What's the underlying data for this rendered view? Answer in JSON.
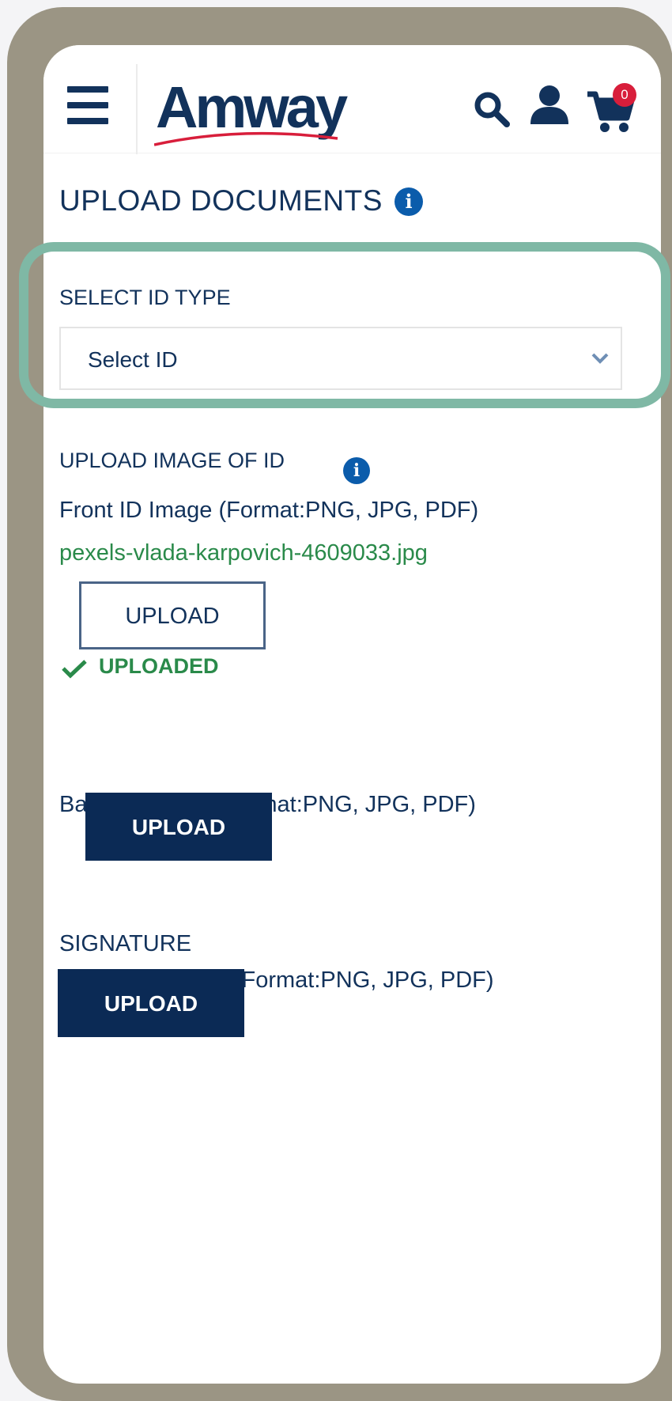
{
  "header": {
    "logo_text": "Amway",
    "cart_count": "0",
    "icons": [
      "hamburger-menu-icon",
      "search-icon",
      "account-icon",
      "cart-icon"
    ]
  },
  "page": {
    "title": "UPLOAD DOCUMENTS"
  },
  "id_type": {
    "label": "SELECT ID TYPE",
    "selected": "Select ID"
  },
  "upload_id": {
    "label": "UPLOAD IMAGE OF ID",
    "front_label": "Front ID Image (Format:PNG, JPG, PDF)",
    "front_file": "pexels-vlada-karpovich-4609033.jpg",
    "front_button": "UPLOAD",
    "front_status": "UPLOADED",
    "back_label": "Back ID Image (Format:PNG, JPG, PDF)",
    "back_button": "UPLOAD"
  },
  "signature": {
    "label": "SIGNATURE",
    "image_label": "Signature Image (Format:PNG, JPG, PDF)",
    "button": "UPLOAD"
  },
  "colors": {
    "brand_navy": "#12325b",
    "button_navy": "#0b2a55",
    "success_green": "#2a8a4a",
    "highlight": "#7fb8a5",
    "badge_red": "#d81e3b",
    "frame": "#9b9584"
  }
}
